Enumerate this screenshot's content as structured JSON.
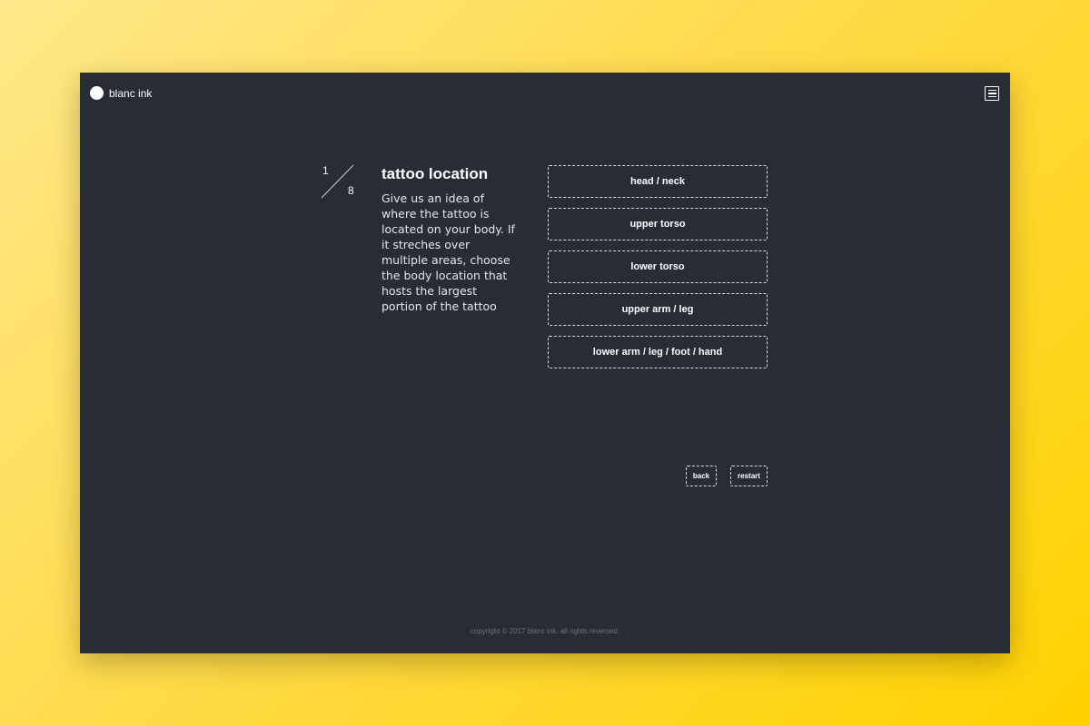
{
  "brand": {
    "name": "blanc ink"
  },
  "header": {
    "menu_icon": "menu-icon"
  },
  "step": {
    "current": "1",
    "total": "8"
  },
  "question": {
    "title": "tattoo location",
    "description": "Give us an idea of where the tattoo is located on your body. If it streches over multiple areas, choose the body location that hosts the largest portion of the tattoo"
  },
  "options": [
    {
      "label": "head / neck"
    },
    {
      "label": "upper torso"
    },
    {
      "label": "lower torso"
    },
    {
      "label": "upper arm / leg"
    },
    {
      "label": "lower arm / leg / foot / hand"
    }
  ],
  "nav": {
    "back_label": "back",
    "restart_label": "restart"
  },
  "footer": {
    "copyright": "copyright © 2017 blanc ink. all rights reversed."
  },
  "colors": {
    "panel": "#282c35",
    "background_accent": "#ffd200",
    "text": "#ffffff"
  }
}
